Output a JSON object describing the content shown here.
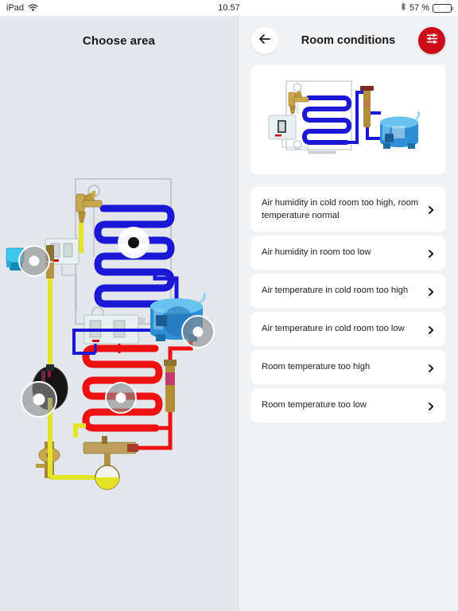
{
  "status_bar": {
    "device": "iPad",
    "wifi_icon": "wifi-icon",
    "time": "10.57",
    "bluetooth_icon": "bluetooth-icon",
    "battery_percent": "57 %",
    "battery_level": 57
  },
  "left_panel": {
    "title": "Choose area",
    "diagram_name": "refrigeration-system-schematic",
    "hotspots": [
      {
        "name": "hotspot-solenoid-valve",
        "label": "Solenoid valve area"
      },
      {
        "name": "hotspot-evaporator",
        "label": "Evaporator area"
      },
      {
        "name": "hotspot-receiver",
        "label": "Receiver area"
      },
      {
        "name": "hotspot-condenser",
        "label": "Condenser area"
      },
      {
        "name": "hotspot-compressor",
        "label": "Compressor area"
      },
      {
        "name": "hotspot-sight-glass",
        "label": "Sight glass area"
      }
    ]
  },
  "right_panel": {
    "header": {
      "back_icon": "arrow-left-icon",
      "title": "Room conditions",
      "filter_icon": "sliders-icon",
      "filter_color": "#cc0c18"
    },
    "diagram_name": "cold-room-evaporator-schematic",
    "chevron_icon": "chevron-right-icon",
    "items": [
      {
        "label": "Air humidity in cold room too high, room temperature normal",
        "two_line": true
      },
      {
        "label": "Air humidity in room too low",
        "two_line": false
      },
      {
        "label": "Air temperature in cold room too high",
        "two_line": false
      },
      {
        "label": "Air temperature in cold room too low",
        "two_line": false
      },
      {
        "label": "Room temperature too high",
        "two_line": false
      },
      {
        "label": "Room temperature too low",
        "two_line": false
      }
    ]
  },
  "colors": {
    "accent_red": "#cc0c18",
    "suction_blue": "#1a17d6",
    "discharge_red": "#ee1111",
    "liquid_yellow": "#e4e427",
    "left_bg": "#e3e7eb",
    "right_bg": "#f1f2f4"
  }
}
